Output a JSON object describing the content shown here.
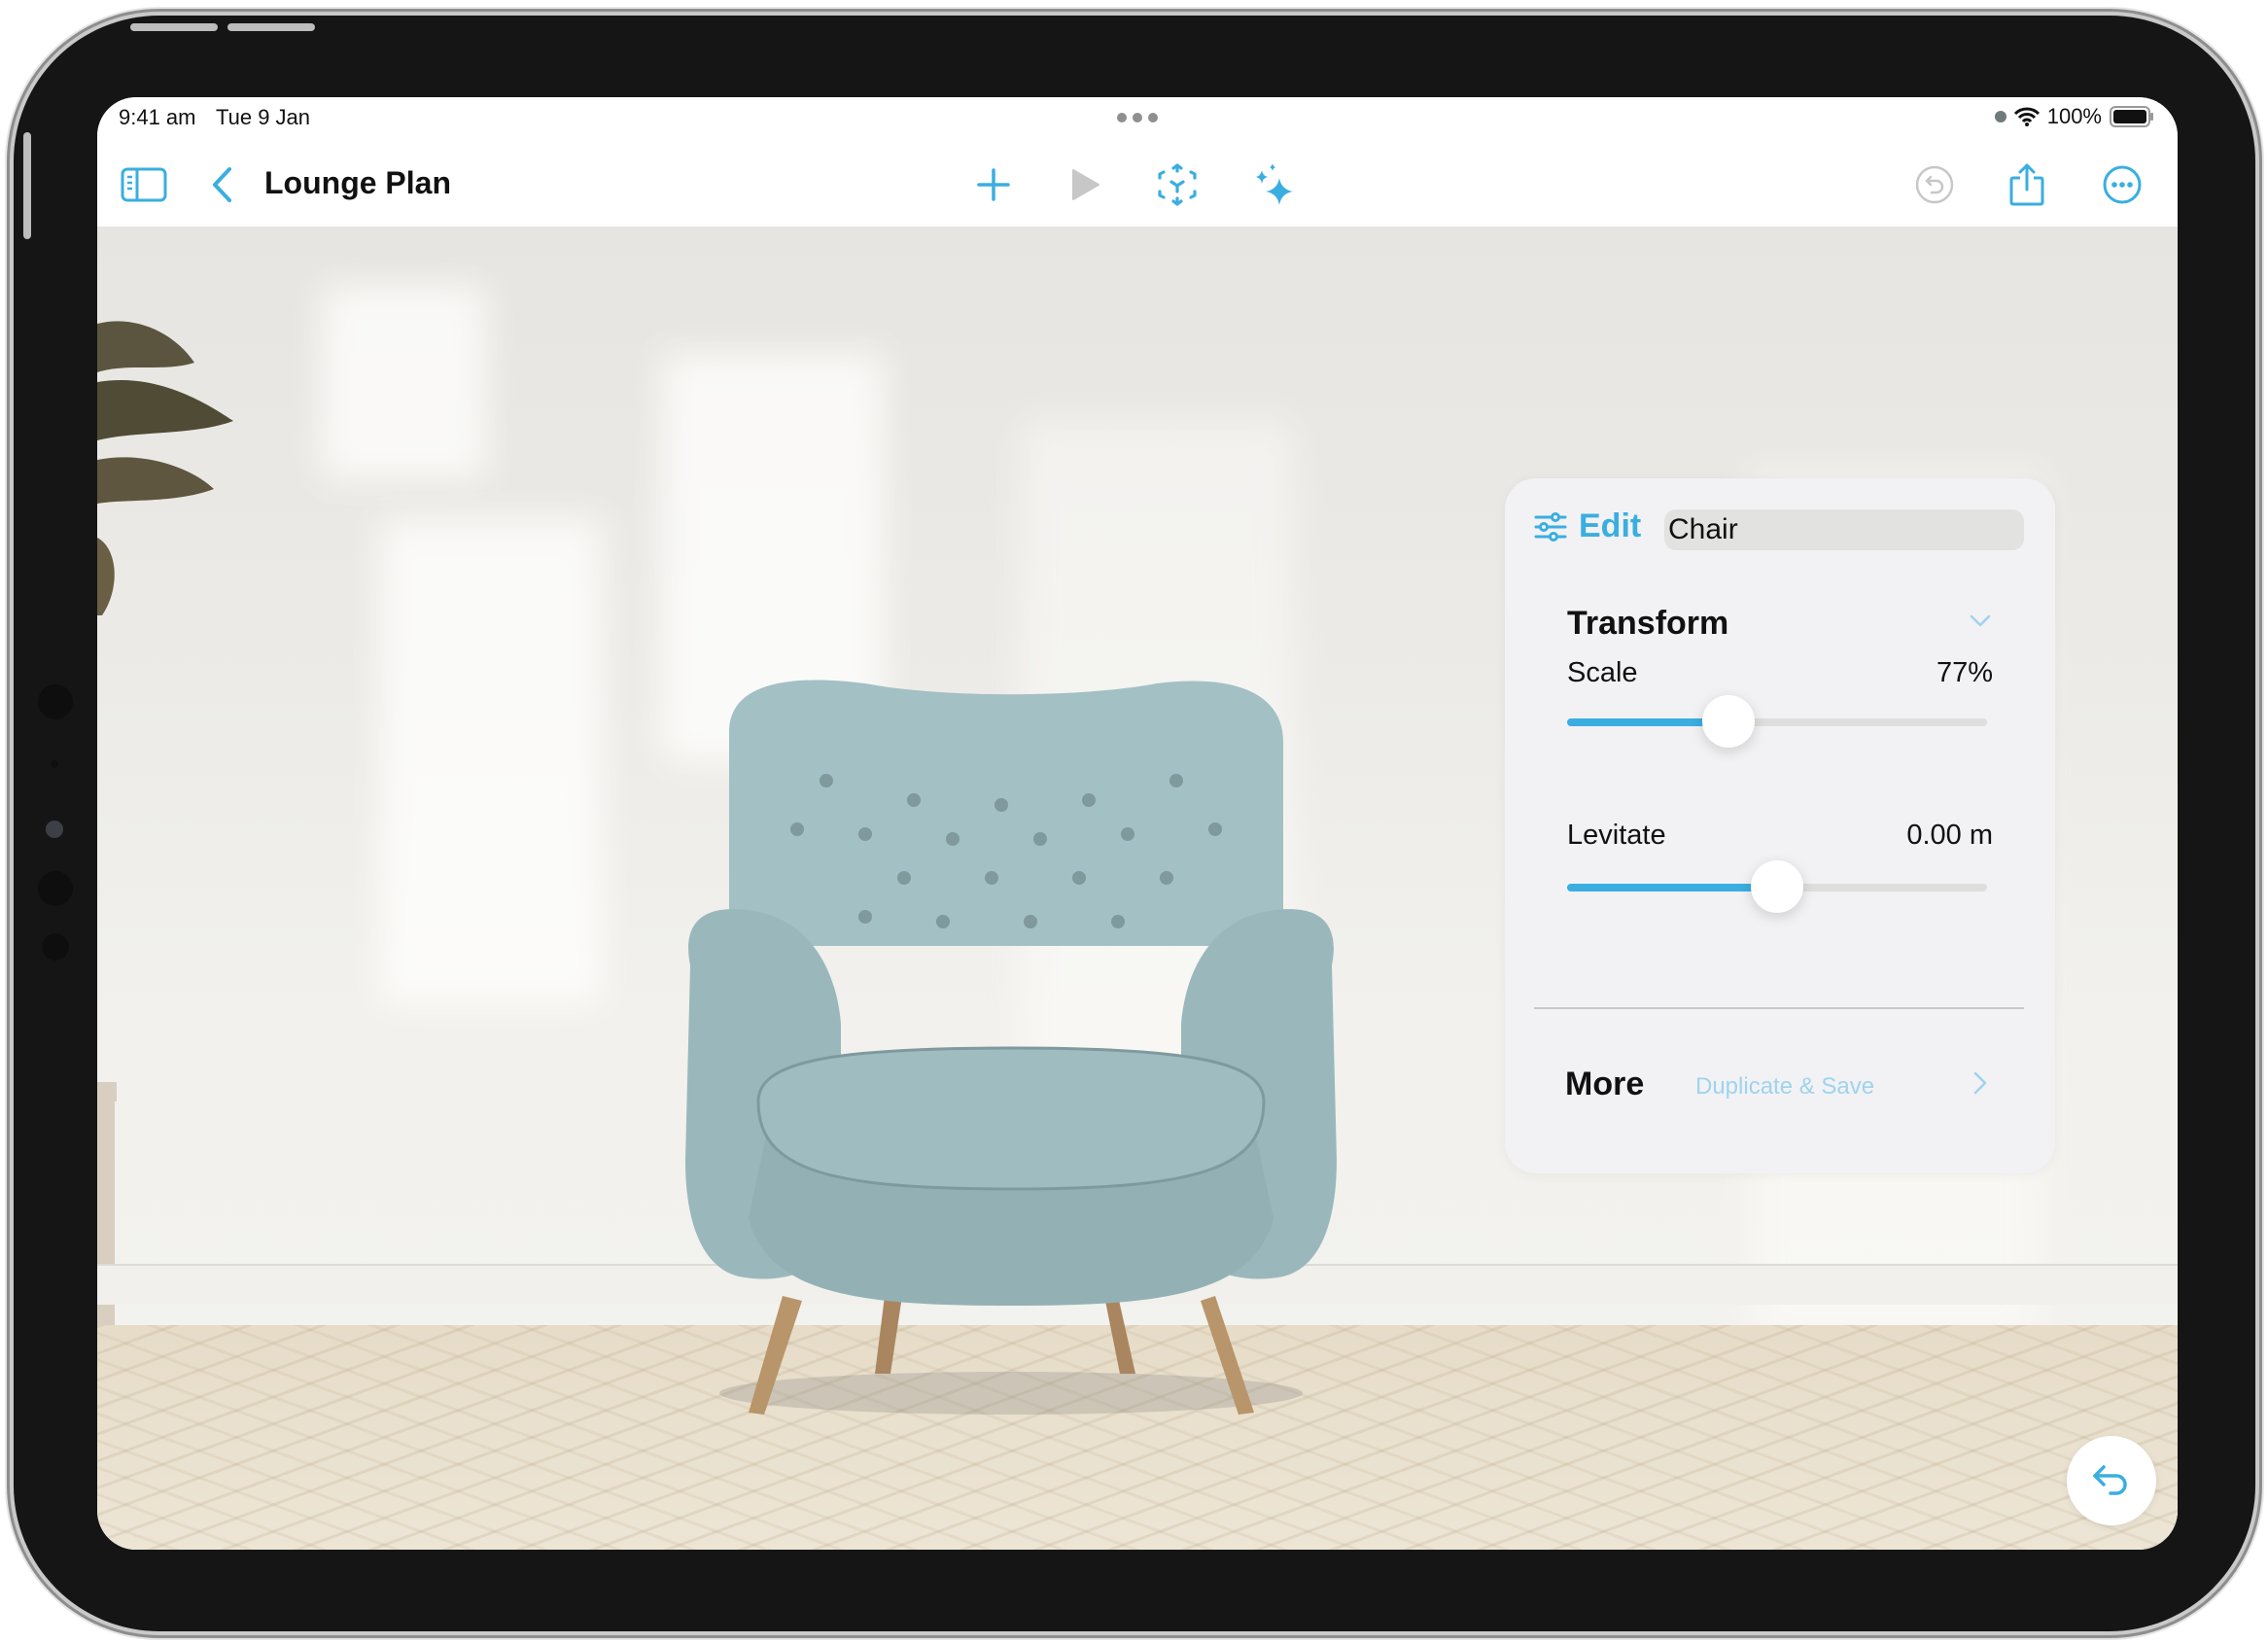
{
  "status_bar": {
    "time": "9:41 am",
    "date": "Tue 9 Jan",
    "battery_percent": "100%",
    "battery_level": 1.0,
    "icons": [
      "multitasking-dots-icon",
      "camera-indicator-icon",
      "wifi-icon",
      "battery-icon"
    ]
  },
  "toolbar": {
    "title": "Lounge Plan",
    "left_buttons": [
      {
        "name": "sidebar-toggle",
        "icon": "sidebar-icon"
      },
      {
        "name": "back",
        "icon": "chevron-left-icon"
      }
    ],
    "center_buttons": [
      {
        "name": "add",
        "icon": "plus-icon",
        "enabled": true
      },
      {
        "name": "play",
        "icon": "play-icon",
        "enabled": false
      },
      {
        "name": "ar-view",
        "icon": "ar-cube-icon",
        "enabled": true
      },
      {
        "name": "magic",
        "icon": "sparkles-icon",
        "enabled": true
      }
    ],
    "right_buttons": [
      {
        "name": "undo",
        "icon": "undo-circle-icon",
        "enabled": false
      },
      {
        "name": "share",
        "icon": "share-icon",
        "enabled": true
      },
      {
        "name": "more",
        "icon": "ellipsis-circle-icon",
        "enabled": true
      }
    ]
  },
  "scene": {
    "object": "armchair",
    "object_color": "#9fbcc0"
  },
  "edit_panel": {
    "header_label": "Edit",
    "object_name": "Chair",
    "section_title": "Transform",
    "section_expanded": true,
    "controls": [
      {
        "label": "Scale",
        "value_text": "77%",
        "fraction": 0.385
      },
      {
        "label": "Levitate",
        "value_text": "0.00 m",
        "fraction": 0.5
      }
    ],
    "more_label": "More",
    "more_link": "Duplicate & Save"
  },
  "floating_button": {
    "name": "undo",
    "icon": "undo-arrow-icon"
  },
  "colors": {
    "accent": "#3aaee0",
    "accent_light": "#9fd3ee",
    "disabled": "#c7c7c7",
    "panel_bg": "#f2f2f4"
  }
}
